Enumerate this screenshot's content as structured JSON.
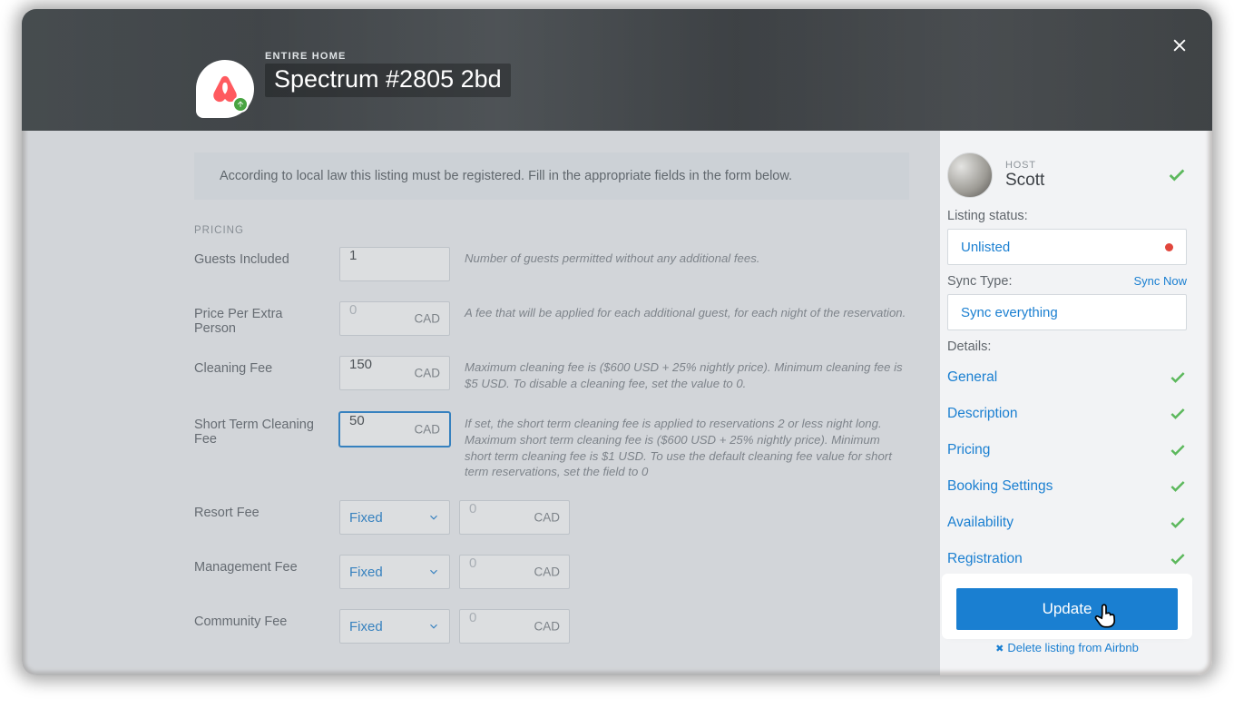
{
  "header": {
    "eyebrow": "ENTIRE HOME",
    "title": "Spectrum #2805 2bd"
  },
  "notice": "According to local law this listing must be registered. Fill in the appropriate fields in the form below.",
  "section": "PRICING",
  "currency": "CAD",
  "fee_type_fixed": "Fixed",
  "rows": {
    "guests_included": {
      "label": "Guests Included",
      "value": "1",
      "help": "Number of guests permitted without any additional fees."
    },
    "price_per_extra": {
      "label": "Price Per Extra Person",
      "value": "",
      "placeholder": "0",
      "help": "A fee that will be applied for each additional guest, for each night of the reservation."
    },
    "cleaning_fee": {
      "label": "Cleaning Fee",
      "value": "150",
      "help": "Maximum cleaning fee is ($600 USD + 25% nightly price). Minimum cleaning fee is $5 USD. To disable a cleaning fee, set the value to 0."
    },
    "short_term_cleaning": {
      "label": "Short Term Cleaning Fee",
      "value": "50",
      "help": "If set, the short term cleaning fee is applied to reservations 2 or less night long. Maximum short term cleaning fee is ($600 USD + 25% nightly price). Minimum short term cleaning fee is $1 USD. To use the default cleaning fee value for short term reservations, set the field to 0"
    },
    "resort_fee": {
      "label": "Resort Fee",
      "placeholder": "0"
    },
    "management_fee": {
      "label": "Management Fee",
      "placeholder": "0"
    },
    "community_fee": {
      "label": "Community Fee",
      "placeholder": "0"
    }
  },
  "side": {
    "host_label": "HOST",
    "host_name": "Scott",
    "listing_status_label": "Listing status:",
    "listing_status_value": "Unlisted",
    "sync_type_label": "Sync Type:",
    "sync_now": "Sync Now",
    "sync_type_value": "Sync everything",
    "details_label": "Details:",
    "details": [
      "General",
      "Description",
      "Pricing",
      "Booking Settings",
      "Availability",
      "Registration"
    ],
    "update": "Update",
    "delete": "Delete listing from Airbnb"
  }
}
